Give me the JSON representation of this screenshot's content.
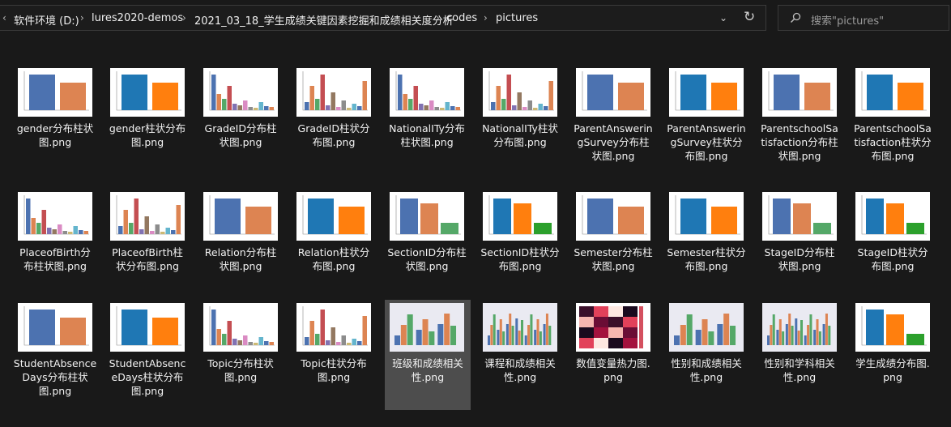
{
  "address": {
    "crumbs": [
      "软件环境 (D:)",
      "lures2020-demos",
      "2021_03_18_学生成绩关键因素挖掘和成绩相关度分析",
      "codes",
      "pictures"
    ],
    "separator": "›"
  },
  "search": {
    "placeholder": "搜索\"pictures\""
  },
  "icons": {
    "back_nav": "chevron-left-icon",
    "crumb_sep": "chevron-right-icon",
    "dropdown": "chevron-down-icon",
    "refresh": "refresh-icon",
    "search": "search-icon"
  },
  "files": [
    {
      "name": "gender分布柱状图.png",
      "label_lines": [
        "gender分布柱状",
        "图.png"
      ],
      "thumb": "bars2"
    },
    {
      "name": "gender柱状分布图.png",
      "label_lines": [
        "gender柱状分布",
        "图.png"
      ],
      "thumb": "bars2c"
    },
    {
      "name": "GradeID分布柱状图.png",
      "label_lines": [
        "GradeID分布柱",
        "状图.png"
      ],
      "thumb": "many"
    },
    {
      "name": "GradeID柱状分布图.png",
      "label_lines": [
        "GradeID柱状分",
        "布图.png"
      ],
      "thumb": "manyc"
    },
    {
      "name": "NationalITy分布柱状图.png",
      "label_lines": [
        "NationalITy分布",
        "柱状图.png"
      ],
      "thumb": "many"
    },
    {
      "name": "NationalITy柱状分布图.png",
      "label_lines": [
        "NationalITy柱状",
        "分布图.png"
      ],
      "thumb": "manyc"
    },
    {
      "name": "ParentAnsweringSurvey分布柱状图.png",
      "label_lines": [
        "ParentAnswerin",
        "gSurvey分布柱",
        "状图.png"
      ],
      "thumb": "bars2"
    },
    {
      "name": "ParentAnsweringSurvey柱状分布图.png",
      "label_lines": [
        "ParentAnswerin",
        "gSurvey柱状分",
        "布图.png"
      ],
      "thumb": "bars2c"
    },
    {
      "name": "ParentschoolSatisfaction分布柱状图.png",
      "label_lines": [
        "ParentschoolSa",
        "tisfaction分布柱",
        "状图.png"
      ],
      "thumb": "bars2"
    },
    {
      "name": "ParentschoolSatisfaction柱状分布图.png",
      "label_lines": [
        "ParentschoolSa",
        "tisfaction柱状分",
        "布图.png"
      ],
      "thumb": "bars2c"
    },
    {
      "name": "PlaceofBirth分布柱状图.png",
      "label_lines": [
        "PlaceofBirth分",
        "布柱状图.png"
      ],
      "thumb": "many"
    },
    {
      "name": "PlaceofBirth柱状分布图.png",
      "label_lines": [
        "PlaceofBirth柱",
        "状分布图.png"
      ],
      "thumb": "manyc"
    },
    {
      "name": "Relation分布柱状图.png",
      "label_lines": [
        "Relation分布柱",
        "状图.png"
      ],
      "thumb": "bars2"
    },
    {
      "name": "Relation柱状分布图.png",
      "label_lines": [
        "Relation柱状分",
        "布图.png"
      ],
      "thumb": "bars2c"
    },
    {
      "name": "SectionID分布柱状图.png",
      "label_lines": [
        "SectionID分布柱",
        "状图.png"
      ],
      "thumb": "bars3"
    },
    {
      "name": "SectionID柱状分布图.png",
      "label_lines": [
        "SectionID柱状分",
        "布图.png"
      ],
      "thumb": "bars3c"
    },
    {
      "name": "Semester分布柱状图.png",
      "label_lines": [
        "Semester分布柱",
        "状图.png"
      ],
      "thumb": "bars2"
    },
    {
      "name": "Semester柱状分布图.png",
      "label_lines": [
        "Semester柱状分",
        "布图.png"
      ],
      "thumb": "bars2c"
    },
    {
      "name": "StageID分布柱状图.png",
      "label_lines": [
        "StageID分布柱",
        "状图.png"
      ],
      "thumb": "bars3"
    },
    {
      "name": "StageID柱状分布图.png",
      "label_lines": [
        "StageID柱状分",
        "布图.png"
      ],
      "thumb": "bars3c"
    },
    {
      "name": "StudentAbsenceDays分布柱状图.png",
      "label_lines": [
        "StudentAbsence",
        "Days分布柱状",
        "图.png"
      ],
      "thumb": "bars2"
    },
    {
      "name": "StudentAbsenceDays柱状分布图.png",
      "label_lines": [
        "StudentAbsenc",
        "eDays柱状分布",
        "图.png"
      ],
      "thumb": "bars2c"
    },
    {
      "name": "Topic分布柱状图.png",
      "label_lines": [
        "Topic分布柱状",
        "图.png"
      ],
      "thumb": "many"
    },
    {
      "name": "Topic柱状分布图.png",
      "label_lines": [
        "Topic柱状分布",
        "图.png"
      ],
      "thumb": "manyc"
    },
    {
      "name": "班级和成绩相关性.png",
      "label_lines": [
        "班级和成绩相关",
        "性.png"
      ],
      "thumb": "grouped",
      "selected": true
    },
    {
      "name": "课程和成绩相关性.png",
      "label_lines": [
        "课程和成绩相关",
        "性.png"
      ],
      "thumb": "groupedwide"
    },
    {
      "name": "数值变量热力图.png",
      "label_lines": [
        "数值变量热力图.",
        "png"
      ],
      "thumb": "heatmap"
    },
    {
      "name": "性别和成绩相关性.png",
      "label_lines": [
        "性别和成绩相关",
        "性.png"
      ],
      "thumb": "grouped"
    },
    {
      "name": "性别和学科相关性.png",
      "label_lines": [
        "性别和学科相关",
        "性.png"
      ],
      "thumb": "groupedwide"
    },
    {
      "name": "学生成绩分布图.png",
      "label_lines": [
        "学生成绩分布图.",
        "png"
      ],
      "thumb": "bars3c"
    }
  ],
  "colors": {
    "background": "#191919",
    "selection": "#4d4d4d",
    "text": "#f2f2f2",
    "bar_blue": "#4c72b0",
    "bar_orange": "#dd8452",
    "bar_green": "#55a868",
    "seaborn_blue": "#1f77b4",
    "seaborn_orange": "#ff7f0e",
    "seaborn_green": "#2ca02c"
  }
}
